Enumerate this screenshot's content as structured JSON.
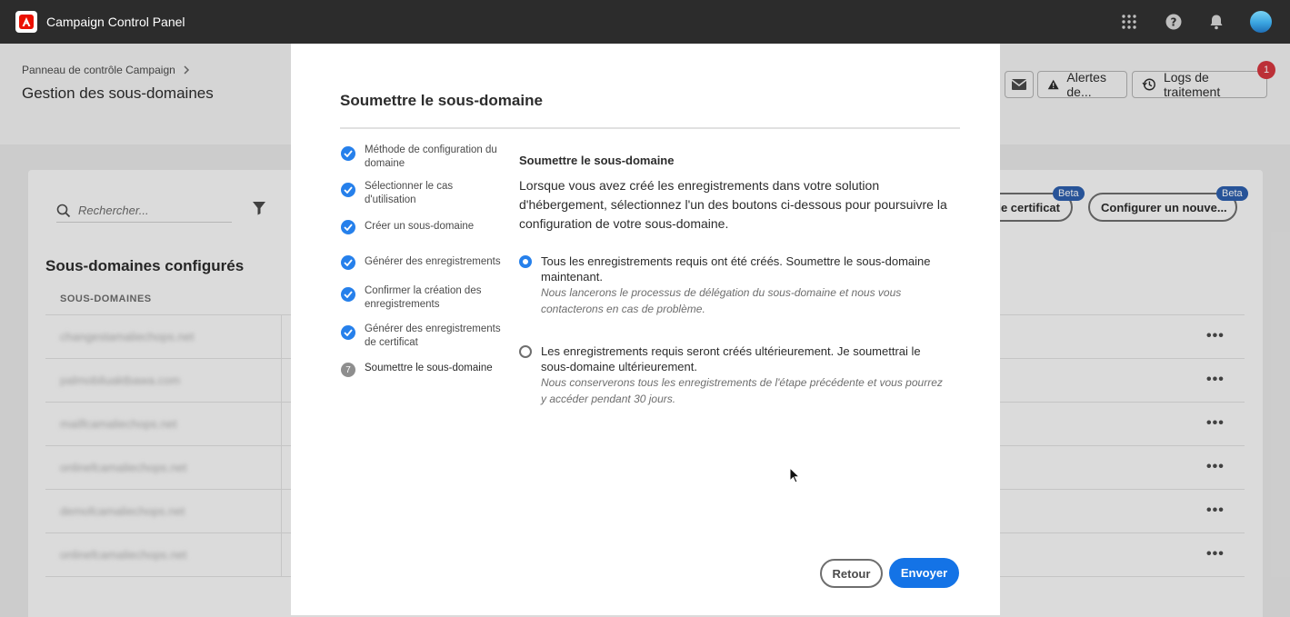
{
  "topbar": {
    "app_title": "Campaign Control Panel",
    "icons": [
      "adobe-logo-icon",
      "apps-grid-icon",
      "help-icon",
      "notifications-bell-icon",
      "user-avatar"
    ]
  },
  "page": {
    "breadcrumb": "Panneau de contrôle Campaign",
    "title": "Gestion des sous-domaines",
    "header_buttons": {
      "alerts_label": "Alertes de...",
      "logs_label": "Logs de traitement",
      "notification_count": "1"
    },
    "search_placeholder": "Rechercher...",
    "section_title": "Sous-domaines configurés",
    "column_header": "SOUS-DOMAINES",
    "rows": [
      {
        "name": "changestamaliechops.net"
      },
      {
        "name": "palmobiluaktbawa.com"
      },
      {
        "name": "mailfcamaliechops.net"
      },
      {
        "name": "onlinefcamaliechops.net"
      },
      {
        "name": "demofcamaliechops.net"
      },
      {
        "name": "onlinefcamaliechops.net"
      }
    ],
    "certificate_button": "le certificat",
    "configure_button": "Configurer un nouve...",
    "beta_label": "Beta"
  },
  "modal": {
    "title": "Soumettre le sous-domaine",
    "steps": [
      {
        "label": "Méthode de configuration du domaine",
        "status": "done"
      },
      {
        "label": "Sélectionner le cas d'utilisation",
        "status": "done"
      },
      {
        "label": "Créer un sous-domaine",
        "status": "done"
      },
      {
        "label": "Générer des enregistrements",
        "status": "done"
      },
      {
        "label": "Confirmer la création des enregistrements",
        "status": "done"
      },
      {
        "label": "Générer des enregistrements de certificat",
        "status": "done"
      },
      {
        "label": "Soumettre le sous-domaine",
        "status": "current",
        "number": "7"
      }
    ],
    "content_title": "Soumettre le sous-domaine",
    "content_description": "Lorsque vous avez créé les enregistrements dans votre solution d'hébergement, sélectionnez l'un des boutons ci-dessous pour poursuivre la configuration de votre sous-domaine.",
    "options": [
      {
        "label": "Tous les enregistrements requis ont été créés. Soumettre le sous-domaine maintenant.",
        "note": "Nous lancerons le processus de délégation du sous-domaine et nous vous contacterons en cas de problème.",
        "selected": true
      },
      {
        "label": "Les enregistrements requis seront créés ultérieurement. Je soumettrai le sous-domaine ultérieurement.",
        "note": "Nous conserverons tous les enregistrements de l'étape précédente et vous pourrez y accéder pendant 30 jours.",
        "selected": false
      }
    ],
    "back_button": "Retour",
    "submit_button": "Envoyer"
  },
  "colors": {
    "accent": "#1473e6",
    "check": "#2680eb",
    "topbar": "#2c2c2c",
    "beta": "#2d5fad",
    "badge": "#d7373f"
  }
}
